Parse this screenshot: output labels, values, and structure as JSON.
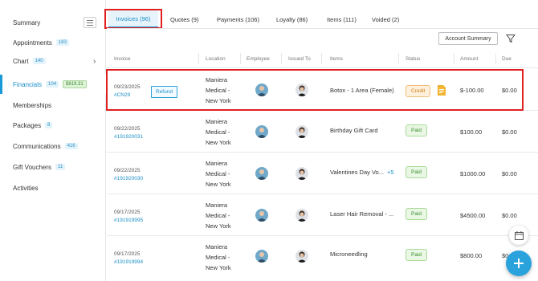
{
  "sidebar": {
    "items": [
      {
        "label": "Summary"
      },
      {
        "label": "Appointments",
        "badge": "183"
      },
      {
        "label": "Chart",
        "badge": "140"
      },
      {
        "label": "Financials",
        "badge": "104",
        "badge2": "$819.31"
      },
      {
        "label": "Memberships"
      },
      {
        "label": "Packages",
        "badge": "8"
      },
      {
        "label": "Communications",
        "badge": "416"
      },
      {
        "label": "Gift Vouchers",
        "badge": "11"
      },
      {
        "label": "Activities"
      }
    ]
  },
  "tabs": [
    {
      "label": "Invoices (96)"
    },
    {
      "label": "Quotes (9)"
    },
    {
      "label": "Payments (106)"
    },
    {
      "label": "Loyalty (86)"
    },
    {
      "label": "Items (111)"
    },
    {
      "label": "Voided (2)"
    }
  ],
  "toolbar": {
    "account_summary": "Account Summary"
  },
  "table": {
    "headers": [
      "Invoice",
      "Location",
      "Employee",
      "Issued To",
      "Items",
      "Status",
      "Amount",
      "Due"
    ],
    "rows": [
      {
        "date": "09/23/2025",
        "number": "#CN29",
        "tag": "Refund",
        "loc1": "Maniera",
        "loc2": "Medical -",
        "loc3": "New York",
        "item": "Botox - 1 Area (Female)",
        "more": "",
        "status": "Credit",
        "amount": "$-100.00",
        "due": "$0.00"
      },
      {
        "date": "09/22/2025",
        "number": "#191920031",
        "tag": "",
        "loc1": "Maniera",
        "loc2": "Medical -",
        "loc3": "New York",
        "item": "Birthday Gift Card",
        "more": "",
        "status": "Paid",
        "amount": "$100.00",
        "due": "$0.00"
      },
      {
        "date": "09/22/2025",
        "number": "#191920030",
        "tag": "",
        "loc1": "Maniera",
        "loc2": "Medical -",
        "loc3": "New York",
        "item": "Valentines Day Vo...",
        "more": "+5",
        "status": "Paid",
        "amount": "$1000.00",
        "due": "$0.00"
      },
      {
        "date": "09/17/2025",
        "number": "#191919995",
        "tag": "",
        "loc1": "Maniera",
        "loc2": "Medical -",
        "loc3": "New York",
        "item": "Laser Hair Removal - ...",
        "more": "",
        "status": "Paid",
        "amount": "$4500.00",
        "due": "$0.00"
      },
      {
        "date": "09/17/2025",
        "number": "#191919994",
        "tag": "",
        "loc1": "Maniera",
        "loc2": "Medical -",
        "loc3": "New York",
        "item": "Microneedling",
        "more": "",
        "status": "Paid",
        "amount": "$800.00",
        "due": "$0.00"
      }
    ]
  },
  "colors": {
    "accent": "#1a9ad6",
    "highlight": "#e02020",
    "paid": "#3a8f2e",
    "credit": "#d07a10"
  },
  "icons": [
    "menu-icon",
    "chevron-right-icon",
    "filter-icon",
    "document-icon",
    "calendar-icon",
    "plus-icon"
  ]
}
